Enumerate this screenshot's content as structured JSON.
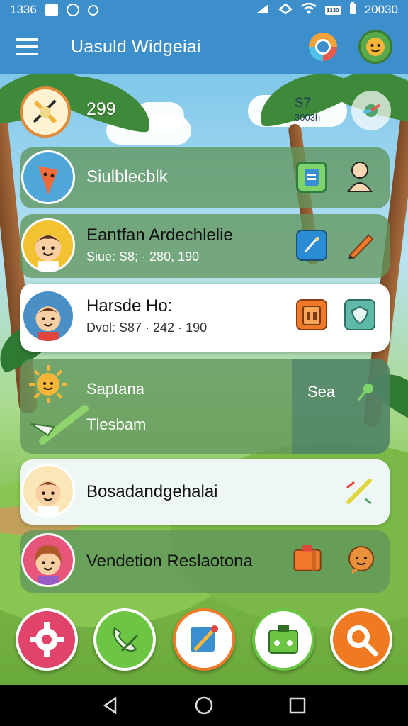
{
  "status_bar": {
    "time": "1336",
    "clock_right": "20030",
    "battery_label": "1330"
  },
  "app_bar": {
    "title": "Uasuld Widgeiai"
  },
  "summary": {
    "left_value": "299",
    "right_value": "S7",
    "right_sub": "3003h"
  },
  "cards": [
    {
      "title": "Siulblecblk",
      "subtitle": ""
    },
    {
      "title": "Eantfan Ardechlelie",
      "subtitle": "Siue: S8; · 280, 190"
    },
    {
      "title": "Harsde Ho:",
      "subtitle": "Dvol: S87 · 242 · 190"
    },
    {
      "title": "Saptana",
      "subtitle": "Tlesbam",
      "right_label": "Sea"
    },
    {
      "title": "Bosadandgehalai",
      "subtitle": ""
    },
    {
      "title": "Vendetion Reslaotona",
      "subtitle": ""
    }
  ],
  "colors": {
    "app_bar": "#3d8fcb",
    "card_glass": "#62965c",
    "action_settings": "#e0446b",
    "action_call": "#6cc643",
    "action_edit": "#ffffff",
    "action_box": "#ffffff",
    "action_search": "#f07a22"
  },
  "icons": {
    "menu": "hamburger-icon",
    "search": "search-icon",
    "profile": "avatar-icon",
    "settings": "gear-icon",
    "call": "phone-icon",
    "edit": "pencil-icon",
    "box": "box-icon",
    "find": "search-icon",
    "nav_back": "back-icon",
    "nav_home": "home-icon",
    "nav_recent": "recent-icon"
  }
}
